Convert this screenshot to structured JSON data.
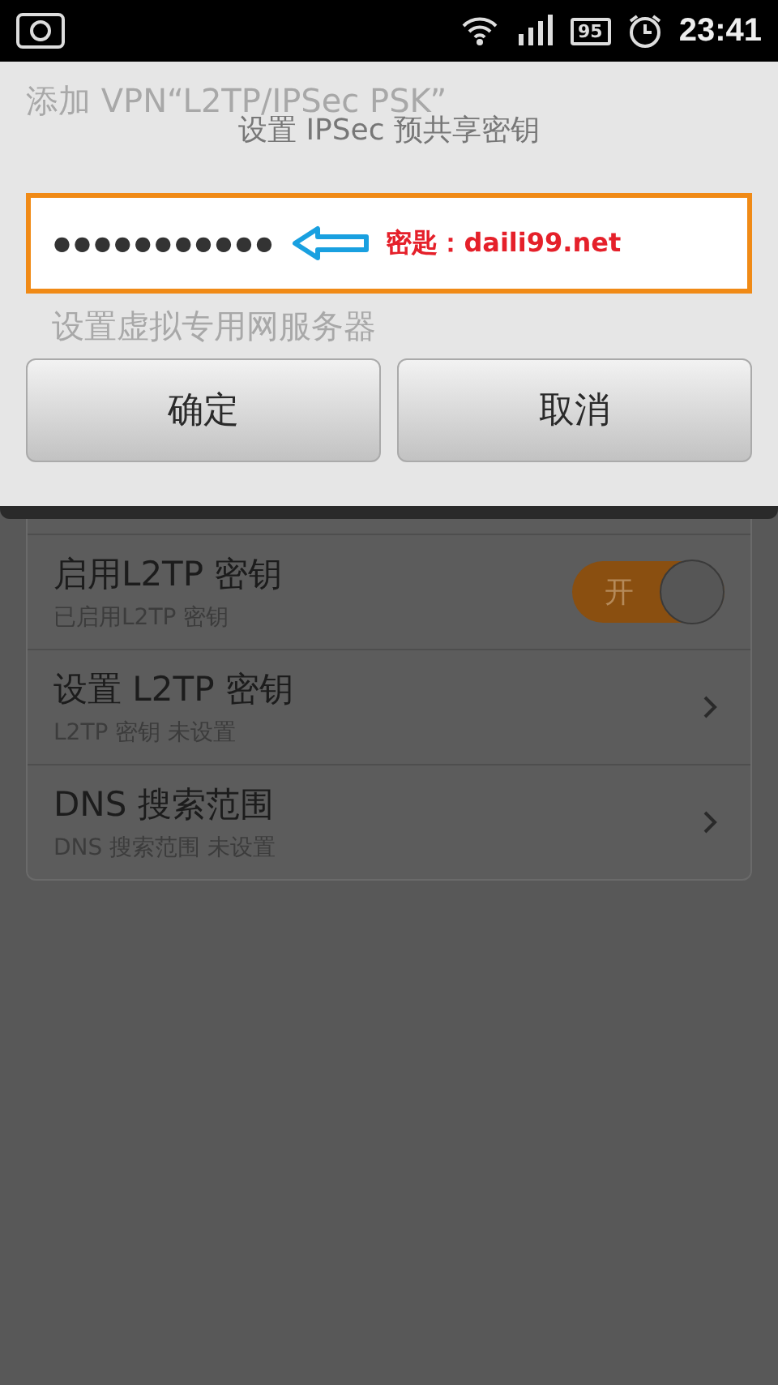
{
  "status_bar": {
    "battery": "95",
    "time": "23:41"
  },
  "background_page": {
    "title": "添加 VPN“L2TP/IPSec PSK”",
    "ghost_row": "设置虚拟专用网服务器",
    "rows": [
      {
        "kind": "toggle",
        "title": "启用L2TP 密钥",
        "subtitle": "已启用L2TP 密钥",
        "toggle_label": "开",
        "on": true
      },
      {
        "kind": "link",
        "title": "设置 L2TP 密钥",
        "subtitle": "L2TP 密钥 未设置"
      },
      {
        "kind": "link",
        "title": "DNS 搜索范围",
        "subtitle": "DNS 搜索范围 未设置"
      }
    ]
  },
  "dialog": {
    "title": "设置 IPSec 预共享密钥",
    "password_value": "●●●●●●●●●●●",
    "annotation": "密匙：daili99.net",
    "buttons": [
      "确定",
      "取消"
    ]
  }
}
